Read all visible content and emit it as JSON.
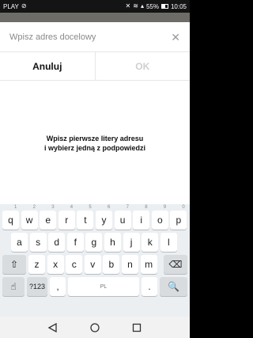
{
  "status": {
    "carrier": "PLAY",
    "battery": "55%",
    "battery_level": 0.55,
    "time": "10:05",
    "icons": [
      "target-icon",
      "mute-icon",
      "wifi-icon",
      "signal-icon",
      "battery-icon"
    ]
  },
  "dialog": {
    "title": "Wpisz adres docelowy",
    "cancel_label": "Anuluj",
    "ok_label": "OK",
    "hint_line1": "Wpisz pierwsze litery adresu",
    "hint_line2": "i wybierz jedną z podpowiedzi"
  },
  "keyboard": {
    "row1": [
      "q",
      "w",
      "e",
      "r",
      "t",
      "y",
      "u",
      "i",
      "o",
      "p"
    ],
    "row1_numbers": [
      "1",
      "2",
      "3",
      "4",
      "5",
      "6",
      "7",
      "8",
      "9",
      "0"
    ],
    "row2": [
      "a",
      "s",
      "d",
      "f",
      "g",
      "h",
      "j",
      "k",
      "l"
    ],
    "row3": [
      "z",
      "x",
      "c",
      "v",
      "b",
      "n",
      "m"
    ],
    "symbols_label": "?123",
    "comma": ",",
    "period": ".",
    "space_label": "PL",
    "colors": {
      "bg": "#eceff1",
      "key": "#ffffff",
      "fn_key": "#d8dcdf"
    }
  }
}
